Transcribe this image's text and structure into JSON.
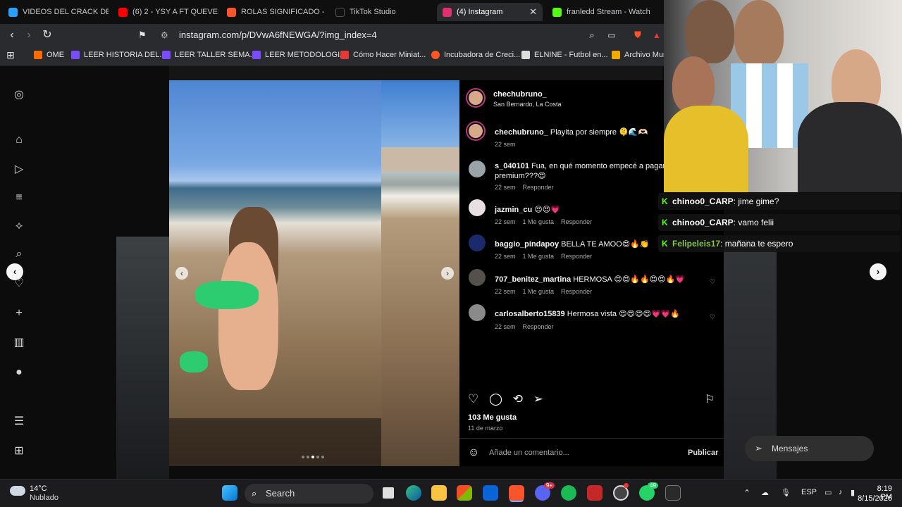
{
  "tabs": [
    {
      "label": "VIDEOS DEL CRACK DE CI",
      "fav": "#2aa1ff"
    },
    {
      "label": "(6) 2 - YSY A FT QUEVEDO",
      "fav": "#ff0000"
    },
    {
      "label": "ROLAS SIGNIFICADO - Br",
      "fav": "#fb542b"
    },
    {
      "label": "TikTok Studio",
      "fav": "#111111"
    },
    {
      "label": "(4) Instagram",
      "fav": "#e1306c",
      "active": true
    },
    {
      "label": "franledd Stream - Watch",
      "fav": "#53fc18"
    }
  ],
  "toolbar": {
    "url": "instagram.com/p/DVwA6fNEWGA/?img_index=4"
  },
  "bookmarks": [
    {
      "label": "OME",
      "color": "#ff6a00"
    },
    {
      "label": "LEER HISTORIA DEL...",
      "color": "#7a4cff"
    },
    {
      "label": "LEER TALLER SEMA...",
      "color": "#7a4cff"
    },
    {
      "label": "LEER METODOLOGIA",
      "color": "#7a4cff"
    },
    {
      "label": "Cómo Hacer Miniat...",
      "color": "#e53935"
    },
    {
      "label": "Incubadora de Creci...",
      "color": "#ff5722"
    },
    {
      "label": "ELNINE - Futbol en...",
      "color": "#dddddd"
    },
    {
      "label": "Archivo Mun",
      "color": "#f2a900"
    }
  ],
  "post": {
    "author": "chechubruno_",
    "location": "San Bernardo, La Costa",
    "caption_user": "chechubruno_",
    "caption_text": "Playita por siempre 🫠🌊🫶🏻",
    "caption_time": "22 sem",
    "likes": "103 Me gusta",
    "date": "11 de marzo",
    "comment_placeholder": "Añade un comentario...",
    "publish_label": "Publicar"
  },
  "comments": [
    {
      "user": "s_040101",
      "text": "Fua, en qué momento empecé a pagar Insta premium???😍",
      "time": "22 sem",
      "likes": "",
      "reply": "Responder"
    },
    {
      "user": "jazmin_cu",
      "text": "😍😍💗",
      "time": "22 sem",
      "likes": "1 Me gusta",
      "reply": "Responder"
    },
    {
      "user": "baggio_pindapoy",
      "text": "BELLA TE AMOO😍🔥👏",
      "time": "22 sem",
      "likes": "1 Me gusta",
      "reply": "Responder"
    },
    {
      "user": "707_benitez_martina",
      "text": "HERMOSA 😍😍🔥🔥😍😍🔥💗",
      "time": "22 sem",
      "likes": "1 Me gusta",
      "reply": "Responder"
    },
    {
      "user": "carlosalberto15839",
      "text": "Hermosa vista 😍😍😍😍💗💗🔥",
      "time": "22 sem",
      "likes": "",
      "reply": "Responder"
    }
  ],
  "chat": [
    {
      "user": "chinoo0_CARP",
      "text": ": jime gime?"
    },
    {
      "user": "chinoo0_CARP",
      "text": ": vamo felii"
    },
    {
      "user": "Felipeleis17",
      "text": ": mañana te espero"
    }
  ],
  "messages_label": "Mensajes",
  "taskbar": {
    "weather_temp": "14°C",
    "weather_desc": "Nublado",
    "search": "Search",
    "lang": "ESP",
    "time": "8:19 PM",
    "date": "8/15/2026",
    "badge_discord": "9+",
    "badge_whatsapp": "49"
  }
}
